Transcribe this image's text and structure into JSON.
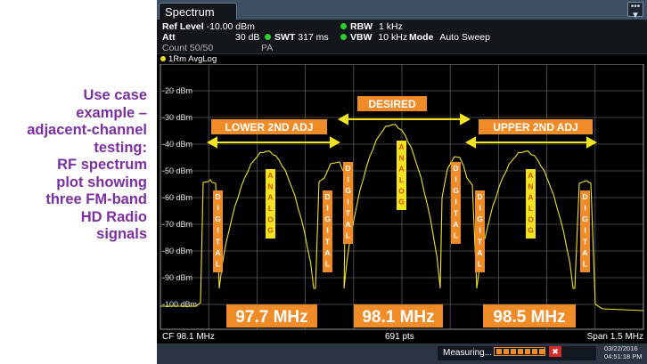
{
  "caption": {
    "lines": [
      "Use case",
      "example –",
      "adjacent-channel",
      "testing:",
      "RF spectrum",
      "plot showing",
      "three FM-band",
      "HD Radio",
      "signals"
    ]
  },
  "tab": {
    "label": "Spectrum"
  },
  "menu_icon": "menu-icon",
  "params": {
    "ref_level_label": "Ref Level",
    "ref_level_value": "-10.00 dBm",
    "att_label": "Att",
    "att_value": "30 dB",
    "swt_label": "SWT",
    "swt_value": "317 ms",
    "rbw_label": "RBW",
    "rbw_value": "1 kHz",
    "vbw_label": "VBW",
    "vbw_value": "10 kHz",
    "mode_label": "Mode",
    "mode_value": "Auto Sweep",
    "count_label": "Count 50/50",
    "pa_label": "PA"
  },
  "trace_label": "1Rm AvgLog",
  "plot": {
    "y_labels": [
      "-20 dBm",
      "-30 dBm",
      "-40 dBm",
      "-50 dBm",
      "-60 dBm",
      "-70 dBm",
      "-80 dBm",
      "-90 dBm",
      "-100 dBm"
    ],
    "labels": {
      "desired": "DESIRED",
      "lower": "LOWER 2ND ADJ",
      "upper": "UPPER 2ND ADJ",
      "freq1": "97.7 MHz",
      "freq2": "98.1 MHz",
      "freq3": "98.5 MHz",
      "digital": "DIGITAL",
      "analog": "ANALOG"
    }
  },
  "bottom": {
    "center": "CF 98.1 MHz",
    "points": "691 pts",
    "span": "Span 1.5 MHz"
  },
  "status": {
    "measuring": "Measuring...",
    "date": "03/22/2016",
    "time": "04:51:18 PM"
  },
  "colors": {
    "caption": "#7b2fa0",
    "trace": "#f2e322",
    "label_bg": "#f08c28",
    "background": "#000000"
  }
}
